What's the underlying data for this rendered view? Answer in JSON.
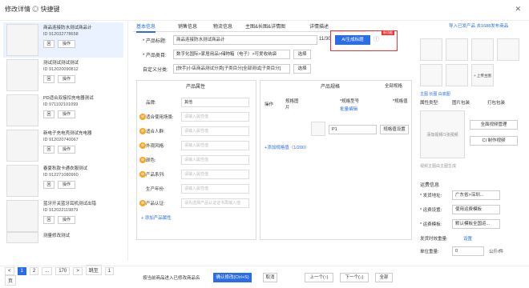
{
  "header": {
    "title": "修改详情 ◎ 快捷键",
    "close": "✕"
  },
  "left": {
    "products": [
      {
        "name": "商品连接防水测试商品计",
        "id": "ID 912032778658",
        "b1": "回",
        "b2": "操作"
      },
      {
        "name": "测试测试测试测试",
        "id": "ID 912020090812",
        "b1": "回",
        "b2": "操作"
      },
      {
        "name": "PD适合双接扣充电器测试",
        "id": "ID 971102101099",
        "b1": "回",
        "b2": "操作"
      },
      {
        "name": "新电子充电壳测试充电器",
        "id": "ID 912020740067",
        "b1": "回",
        "b2": "操作"
      },
      {
        "name": "春夏秋款卡通衣服测试",
        "id": "ID 912271080960",
        "b1": "回",
        "b2": "操作"
      },
      {
        "name": "蓝牙开关蓝牙耳机测试出错",
        "id": "ID 912022119879",
        "b1": "回",
        "b2": "操作"
      },
      {
        "name": "测量修改测试",
        "id": "ID 912023333333",
        "b1": "回",
        "b2": "操作"
      }
    ],
    "pager": [
      "<",
      "1",
      "2",
      "...",
      "170",
      ">",
      "跳至",
      "1",
      "页"
    ]
  },
  "tabs": [
    "基本信息",
    "销售信息",
    "物流信息",
    "主图&长图&详情图",
    "详情描述"
  ],
  "tabs_right": "导入已发产品 去1688发布商品",
  "form": {
    "title_label": "* 产品标题:",
    "title_value": "商品连接防水测试商品计",
    "title_count": "11/30",
    "ai_button": "AI生成标题",
    "ai_badge": "新功能",
    "category_label": "* 产品类目:",
    "category_value": "数字化国际>家居用品>储物箱（电子）>可爱收纳袋",
    "category_btn": "选择",
    "custom_label": "自定义分类:",
    "custom_value": "[快手]小店商品测试分类[子类目分]全部测试[子类目分]",
    "custom_btn": "选择"
  },
  "attrs": {
    "header": "产品属性",
    "rows": [
      {
        "label": "品牌:",
        "value": "其他"
      },
      {
        "label": "适合使用场景:",
        "value": "请输入属性值"
      },
      {
        "label": "适合人群:",
        "value": "请输入属性值"
      },
      {
        "label": "外观风格:",
        "value": "请输入属性值"
      },
      {
        "label": "颜色:",
        "value": "请输入属性值"
      },
      {
        "label": "产品系列:",
        "value": "请输入属性值"
      },
      {
        "label": "生产年份:",
        "value": "请输入属性值"
      },
      {
        "label": "产品认证:",
        "value": "请先选择产品认证证书再输入值"
      }
    ],
    "add": "+ 添加产品属性"
  },
  "spec": {
    "header": "产品规格",
    "all_select": "全部规格",
    "cols": [
      "操作",
      "规格图片",
      "*规格型号",
      "*规格值"
    ],
    "sku_link": "批量编辑",
    "row_value": "P1",
    "row_action": "规格值设置",
    "add": "+添加规格值（1/200）"
  },
  "right": {
    "images_label": "+ 上传主图",
    "thumb_label": "点击上传图片",
    "hint": "主图 长图 白底图",
    "style_label": "属性类型:",
    "style_opt1": "图片包装",
    "style_opt2": "打包包装",
    "video_label": "添加视频/1张视频",
    "video_btn1": "全面视频管理",
    "video_btn2": "CI 制作视频",
    "video_hint": "视频主图由主图生成",
    "shipping_header": "运费信息",
    "ship_rows": [
      {
        "label": "* 发货地址:",
        "value": "广东省>深圳..."
      },
      {
        "label": "* 运费设置:",
        "value": "使用运费模板"
      },
      {
        "label": "* 运费模板:",
        "value": "默认模板全国运..."
      }
    ],
    "weight_label": "发货时效重量:",
    "weight_link": "设置",
    "volume_label": "单位重量:",
    "volume_value": "0",
    "volume_unit": "公斤/件"
  },
  "footer": {
    "check": "按当前商品进入已修改商品名",
    "save": "确认修改(Ctrl+S)",
    "cancel": "取消",
    "prev": "上一个(↑)",
    "next": "下一个(↓)",
    "apply": "全部"
  }
}
